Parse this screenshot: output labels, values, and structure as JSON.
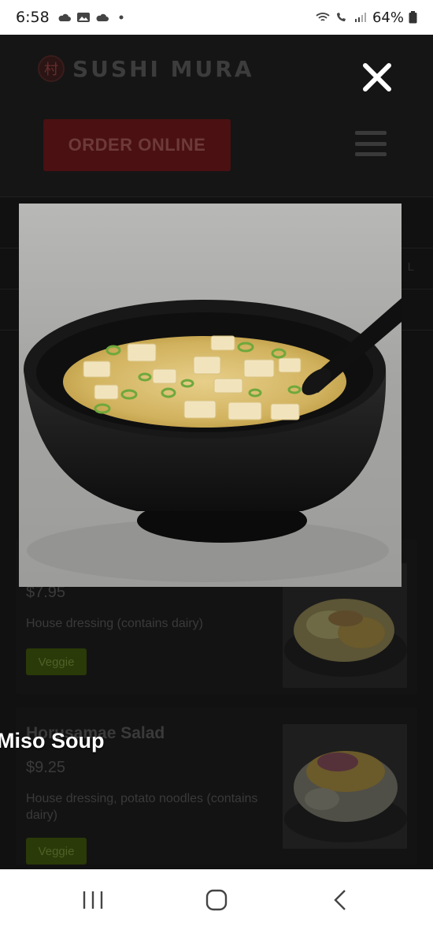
{
  "status": {
    "time": "6:58",
    "battery": "64%"
  },
  "header": {
    "logo_text": "SUSHI MURA",
    "logo_mark": "村",
    "order_label": "ORDER ONLINE"
  },
  "tabs": {
    "fragment": "L"
  },
  "items": [
    {
      "name": "",
      "price": "$7.95",
      "description": "House dressing (contains dairy)",
      "tag": "Veggie"
    },
    {
      "name": "Horusamae Salad",
      "price": "$9.25",
      "description": "House dressing, potato noodles (contains dairy)",
      "tag": "Veggie"
    }
  ],
  "viewer": {
    "caption": "Miso Soup",
    "close_icon": "close-icon"
  },
  "nav": {
    "recents_icon": "recents-icon",
    "home_icon": "home-icon",
    "back_icon": "back-icon"
  },
  "colors": {
    "brand_red": "#4a1012",
    "veggie_green": "#2a3a08",
    "overlay_bg": "#0d0d0d"
  }
}
